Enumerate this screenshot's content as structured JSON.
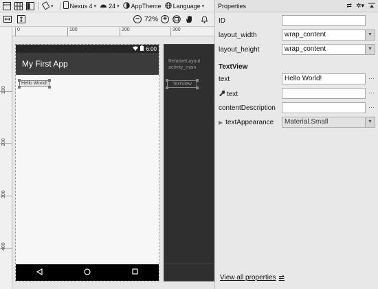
{
  "toolbar": {
    "device": "Nexus 4",
    "api": "24",
    "theme": "AppTheme",
    "language": "Language",
    "zoom": "72%"
  },
  "ruler": {
    "top_ticks": [
      "0",
      "100",
      "200",
      "300"
    ],
    "left_ticks": [
      "100",
      "200",
      "300",
      "400"
    ]
  },
  "preview": {
    "status_time": "6:00",
    "app_title": "My First App",
    "textview_text": "Hello World!"
  },
  "blueprint": {
    "layout_label": "RelativeLayout",
    "layout_id": "activity_main",
    "textview_label": "TextView"
  },
  "properties": {
    "title": "Properties",
    "id_label": "ID",
    "id_value": "",
    "layout_width_label": "layout_width",
    "layout_width_value": "wrap_content",
    "layout_height_label": "layout_height",
    "layout_height_value": "wrap_content",
    "section_label": "TextView",
    "text_label": "text",
    "text_value": "Hello World!",
    "tools_text_label": "text",
    "tools_text_value": "",
    "content_desc_label": "contentDescription",
    "content_desc_value": "",
    "text_appearance_label": "textAppearance",
    "text_appearance_value": "Material.Small",
    "view_all": "View all properties"
  }
}
